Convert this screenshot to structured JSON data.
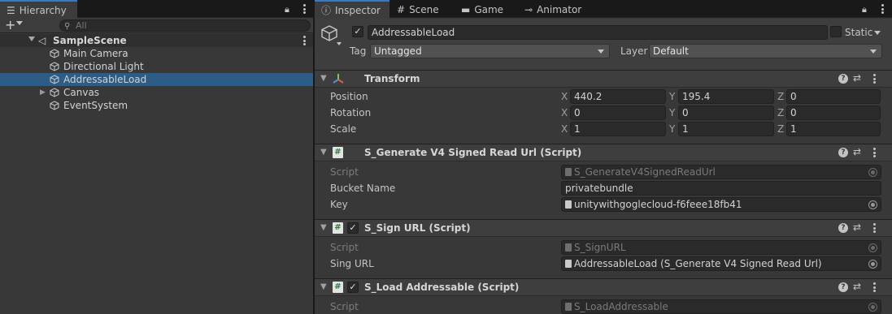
{
  "hierarchy": {
    "tab_label": "Hierarchy",
    "search_placeholder": "All",
    "scene_name": "SampleScene",
    "items": [
      {
        "label": "Main Camera",
        "selected": false,
        "expandable": false
      },
      {
        "label": "Directional Light",
        "selected": false,
        "expandable": false
      },
      {
        "label": "AddressableLoad",
        "selected": true,
        "expandable": false
      },
      {
        "label": "Canvas",
        "selected": false,
        "expandable": true
      },
      {
        "label": "EventSystem",
        "selected": false,
        "expandable": false
      }
    ]
  },
  "tabs": [
    {
      "label": "Inspector",
      "icon": "info-icon",
      "active": true
    },
    {
      "label": "Scene",
      "icon": "grid-icon",
      "active": false
    },
    {
      "label": "Game",
      "icon": "gamepad-icon",
      "active": false
    },
    {
      "label": "Animator",
      "icon": "animator-icon",
      "active": false
    }
  ],
  "object": {
    "name": "AddressableLoad",
    "active": true,
    "static_label": "Static",
    "static": false,
    "tag_label": "Tag",
    "tag_value": "Untagged",
    "layer_label": "Layer",
    "layer_value": "Default"
  },
  "transform": {
    "title": "Transform",
    "position_label": "Position",
    "rotation_label": "Rotation",
    "scale_label": "Scale",
    "axis_x": "X",
    "axis_y": "Y",
    "axis_z": "Z",
    "position": {
      "x": "440.2",
      "y": "195.4",
      "z": "0"
    },
    "rotation": {
      "x": "0",
      "y": "0",
      "z": "0"
    },
    "scale": {
      "x": "1",
      "y": "1",
      "z": "1"
    }
  },
  "components": [
    {
      "title": "S_Generate V4 Signed Read Url (Script)",
      "script_label": "Script",
      "script_value": "S_GenerateV4SignedReadUrl",
      "bucket_label": "Bucket Name",
      "bucket_value": "privatebundle",
      "key_label": "Key",
      "key_value": "unitywithgoglecloud-f6feee18fb41"
    },
    {
      "title": "S_Sign URL (Script)",
      "enabled": true,
      "script_label": "Script",
      "script_value": "S_SignURL",
      "sign_label": "Sing URL",
      "sign_value": "AddressableLoad (S_Generate V4 Signed Read Url)"
    },
    {
      "title": "S_Load Addressable (Script)",
      "enabled": true,
      "script_label": "Script",
      "script_value": "S_LoadAddressable"
    }
  ],
  "colors": {
    "selection": "#2c5d87",
    "active_tab_accent": "#3a79bb",
    "panel_bg": "#383838"
  }
}
